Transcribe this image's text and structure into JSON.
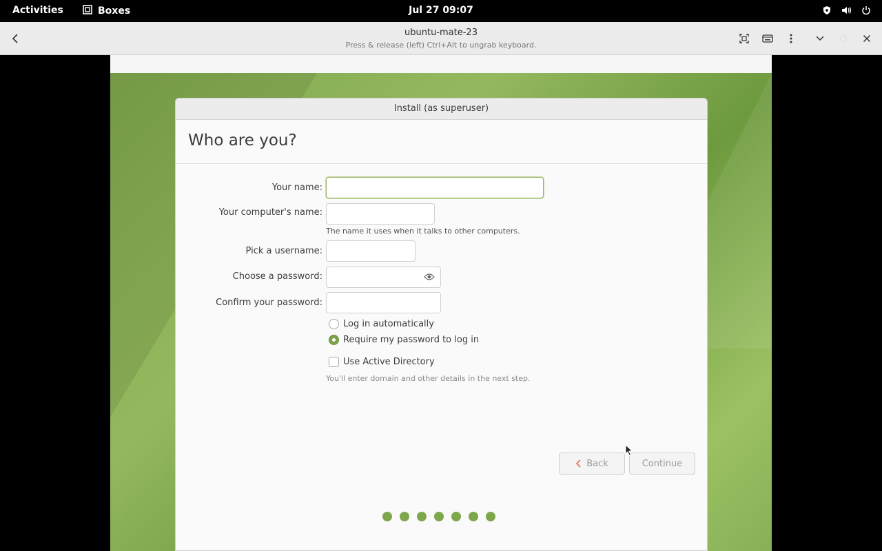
{
  "topbar": {
    "activities": "Activities",
    "app_name": "Boxes",
    "clock": "Jul 27  09:07",
    "tray_icons": [
      "shield-icon",
      "volume-icon",
      "power-icon"
    ]
  },
  "headerbar": {
    "title": "ubuntu-mate-23",
    "subtitle": "Press & release (left) Ctrl+Alt to ungrab keyboard.",
    "actions": [
      "fullscreen-icon",
      "keyboard-icon",
      "menu-dots-icon",
      "chevron-down-icon",
      "close-icon"
    ]
  },
  "installer": {
    "window_title": "Install (as superuser)",
    "heading": "Who are you?",
    "fields": {
      "name": {
        "label": "Your name:",
        "value": ""
      },
      "computer": {
        "label": "Your computer's name:",
        "value": "",
        "hint": "The name it uses when it talks to other computers."
      },
      "username": {
        "label": "Pick a username:",
        "value": ""
      },
      "password": {
        "label": "Choose a password:",
        "value": ""
      },
      "confirm": {
        "label": "Confirm your password:",
        "value": ""
      }
    },
    "login_options": {
      "auto": {
        "label": "Log in automatically",
        "checked": false
      },
      "require": {
        "label": "Require my password to log in",
        "checked": true
      }
    },
    "active_directory": {
      "label": "Use Active Directory",
      "checked": false,
      "hint": "You'll enter domain and other details in the next step."
    },
    "buttons": {
      "back": "Back",
      "continue": "Continue"
    },
    "progress": {
      "total_steps": 7
    }
  },
  "colors": {
    "accent": "#7ea74c",
    "topbar": "#000000",
    "headerbar": "#ebebeb"
  }
}
